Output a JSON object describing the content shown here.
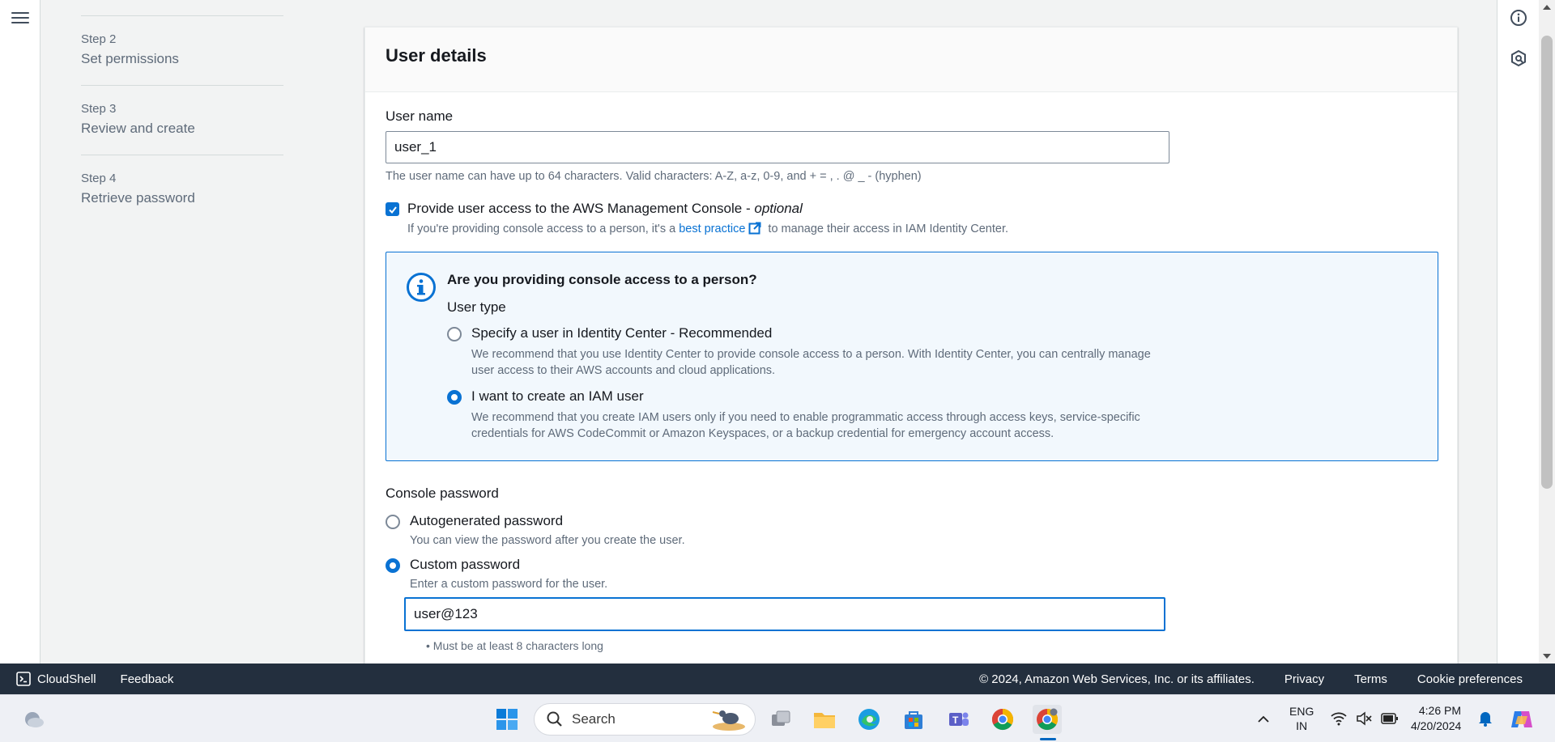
{
  "steps": [
    {
      "num": "Step 2",
      "label": "Set permissions"
    },
    {
      "num": "Step 3",
      "label": "Review and create"
    },
    {
      "num": "Step 4",
      "label": "Retrieve password"
    }
  ],
  "card": {
    "title": "User details",
    "user_name": {
      "label": "User name",
      "value": "user_1",
      "hint": "The user name can have up to 64 characters. Valid characters: A-Z, a-z, 0-9, and + = , . @ _ - (hyphen)"
    },
    "console_access": {
      "label": "Provide user access to the AWS Management Console - ",
      "label_optional": "optional",
      "checked": true,
      "desc_before": "If you're providing console access to a person, it's a ",
      "desc_link": "best practice",
      "desc_after": " to manage their access in IAM Identity Center."
    },
    "info_box": {
      "title": "Are you providing console access to a person?",
      "user_type_label": "User type",
      "options": [
        {
          "title": "Specify a user in Identity Center - Recommended",
          "desc": "We recommend that you use Identity Center to provide console access to a person. With Identity Center, you can centrally manage user access to their AWS accounts and cloud applications.",
          "selected": false
        },
        {
          "title": "I want to create an IAM user",
          "desc": "We recommend that you create IAM users only if you need to enable programmatic access through access keys, service-specific credentials for AWS CodeCommit or Amazon Keyspaces, or a backup credential for emergency account access.",
          "selected": true
        }
      ]
    },
    "console_password": {
      "label": "Console password",
      "autogenerated": {
        "title": "Autogenerated password",
        "desc": "You can view the password after you create the user.",
        "selected": false
      },
      "custom": {
        "title": "Custom password",
        "desc": "Enter a custom password for the user.",
        "selected": true,
        "value": "user@123"
      },
      "rule": "Must be at least 8 characters long"
    }
  },
  "footer": {
    "cloudshell": "CloudShell",
    "feedback": "Feedback",
    "copyright": "© 2024, Amazon Web Services, Inc. or its affiliates.",
    "privacy": "Privacy",
    "terms": "Terms",
    "cookies": "Cookie preferences"
  },
  "taskbar": {
    "search": "Search",
    "lang_line1": "ENG",
    "lang_line2": "IN",
    "time": "4:26 PM",
    "date": "4/20/2024"
  },
  "colors": {
    "accent": "#0972d3",
    "footer_bg": "#232f3e"
  }
}
